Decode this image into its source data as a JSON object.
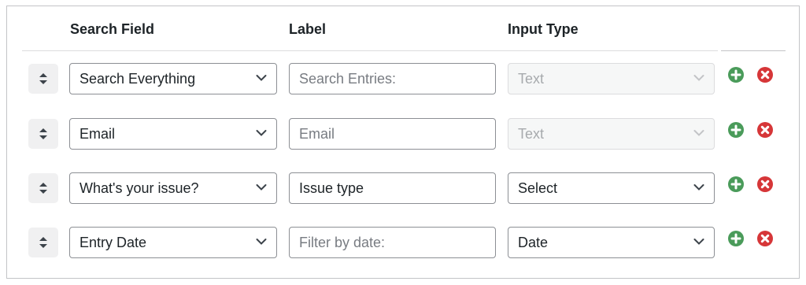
{
  "headers": {
    "search_field": "Search Field",
    "label": "Label",
    "input_type": "Input Type"
  },
  "rows": [
    {
      "search_field": "Search Everything",
      "label": "Search Entries:",
      "label_is_placeholder": true,
      "input_type": "Text",
      "input_type_disabled": true
    },
    {
      "search_field": "Email",
      "label": "Email",
      "label_is_placeholder": true,
      "input_type": "Text",
      "input_type_disabled": true
    },
    {
      "search_field": "What's your issue?",
      "label": "Issue type",
      "label_is_placeholder": false,
      "input_type": "Select",
      "input_type_disabled": false
    },
    {
      "search_field": "Entry Date",
      "label": "Filter by date:",
      "label_is_placeholder": true,
      "input_type": "Date",
      "input_type_disabled": false
    }
  ],
  "icons": {
    "drag": "sort-arrows-icon",
    "add": "plus-circle-icon",
    "remove": "x-circle-icon",
    "dropdown": "chevron-down-icon"
  },
  "colors": {
    "add": "#4a9b5a",
    "remove": "#d63638",
    "border": "#8c8f94",
    "disabled_text": "#a7aaad"
  }
}
